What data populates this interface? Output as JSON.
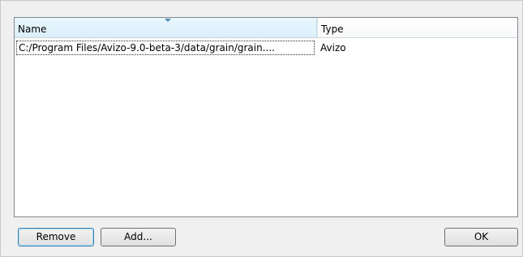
{
  "list": {
    "columns": [
      {
        "label": "Name"
      },
      {
        "label": "Type"
      }
    ],
    "rows": [
      {
        "name": "C:/Program Files/Avizo-9.0-beta-3/data/grain/grain....",
        "type": "Avizo"
      }
    ]
  },
  "buttons": {
    "remove_label": "Remove",
    "add_label": "Add...",
    "ok_label": "OK"
  }
}
